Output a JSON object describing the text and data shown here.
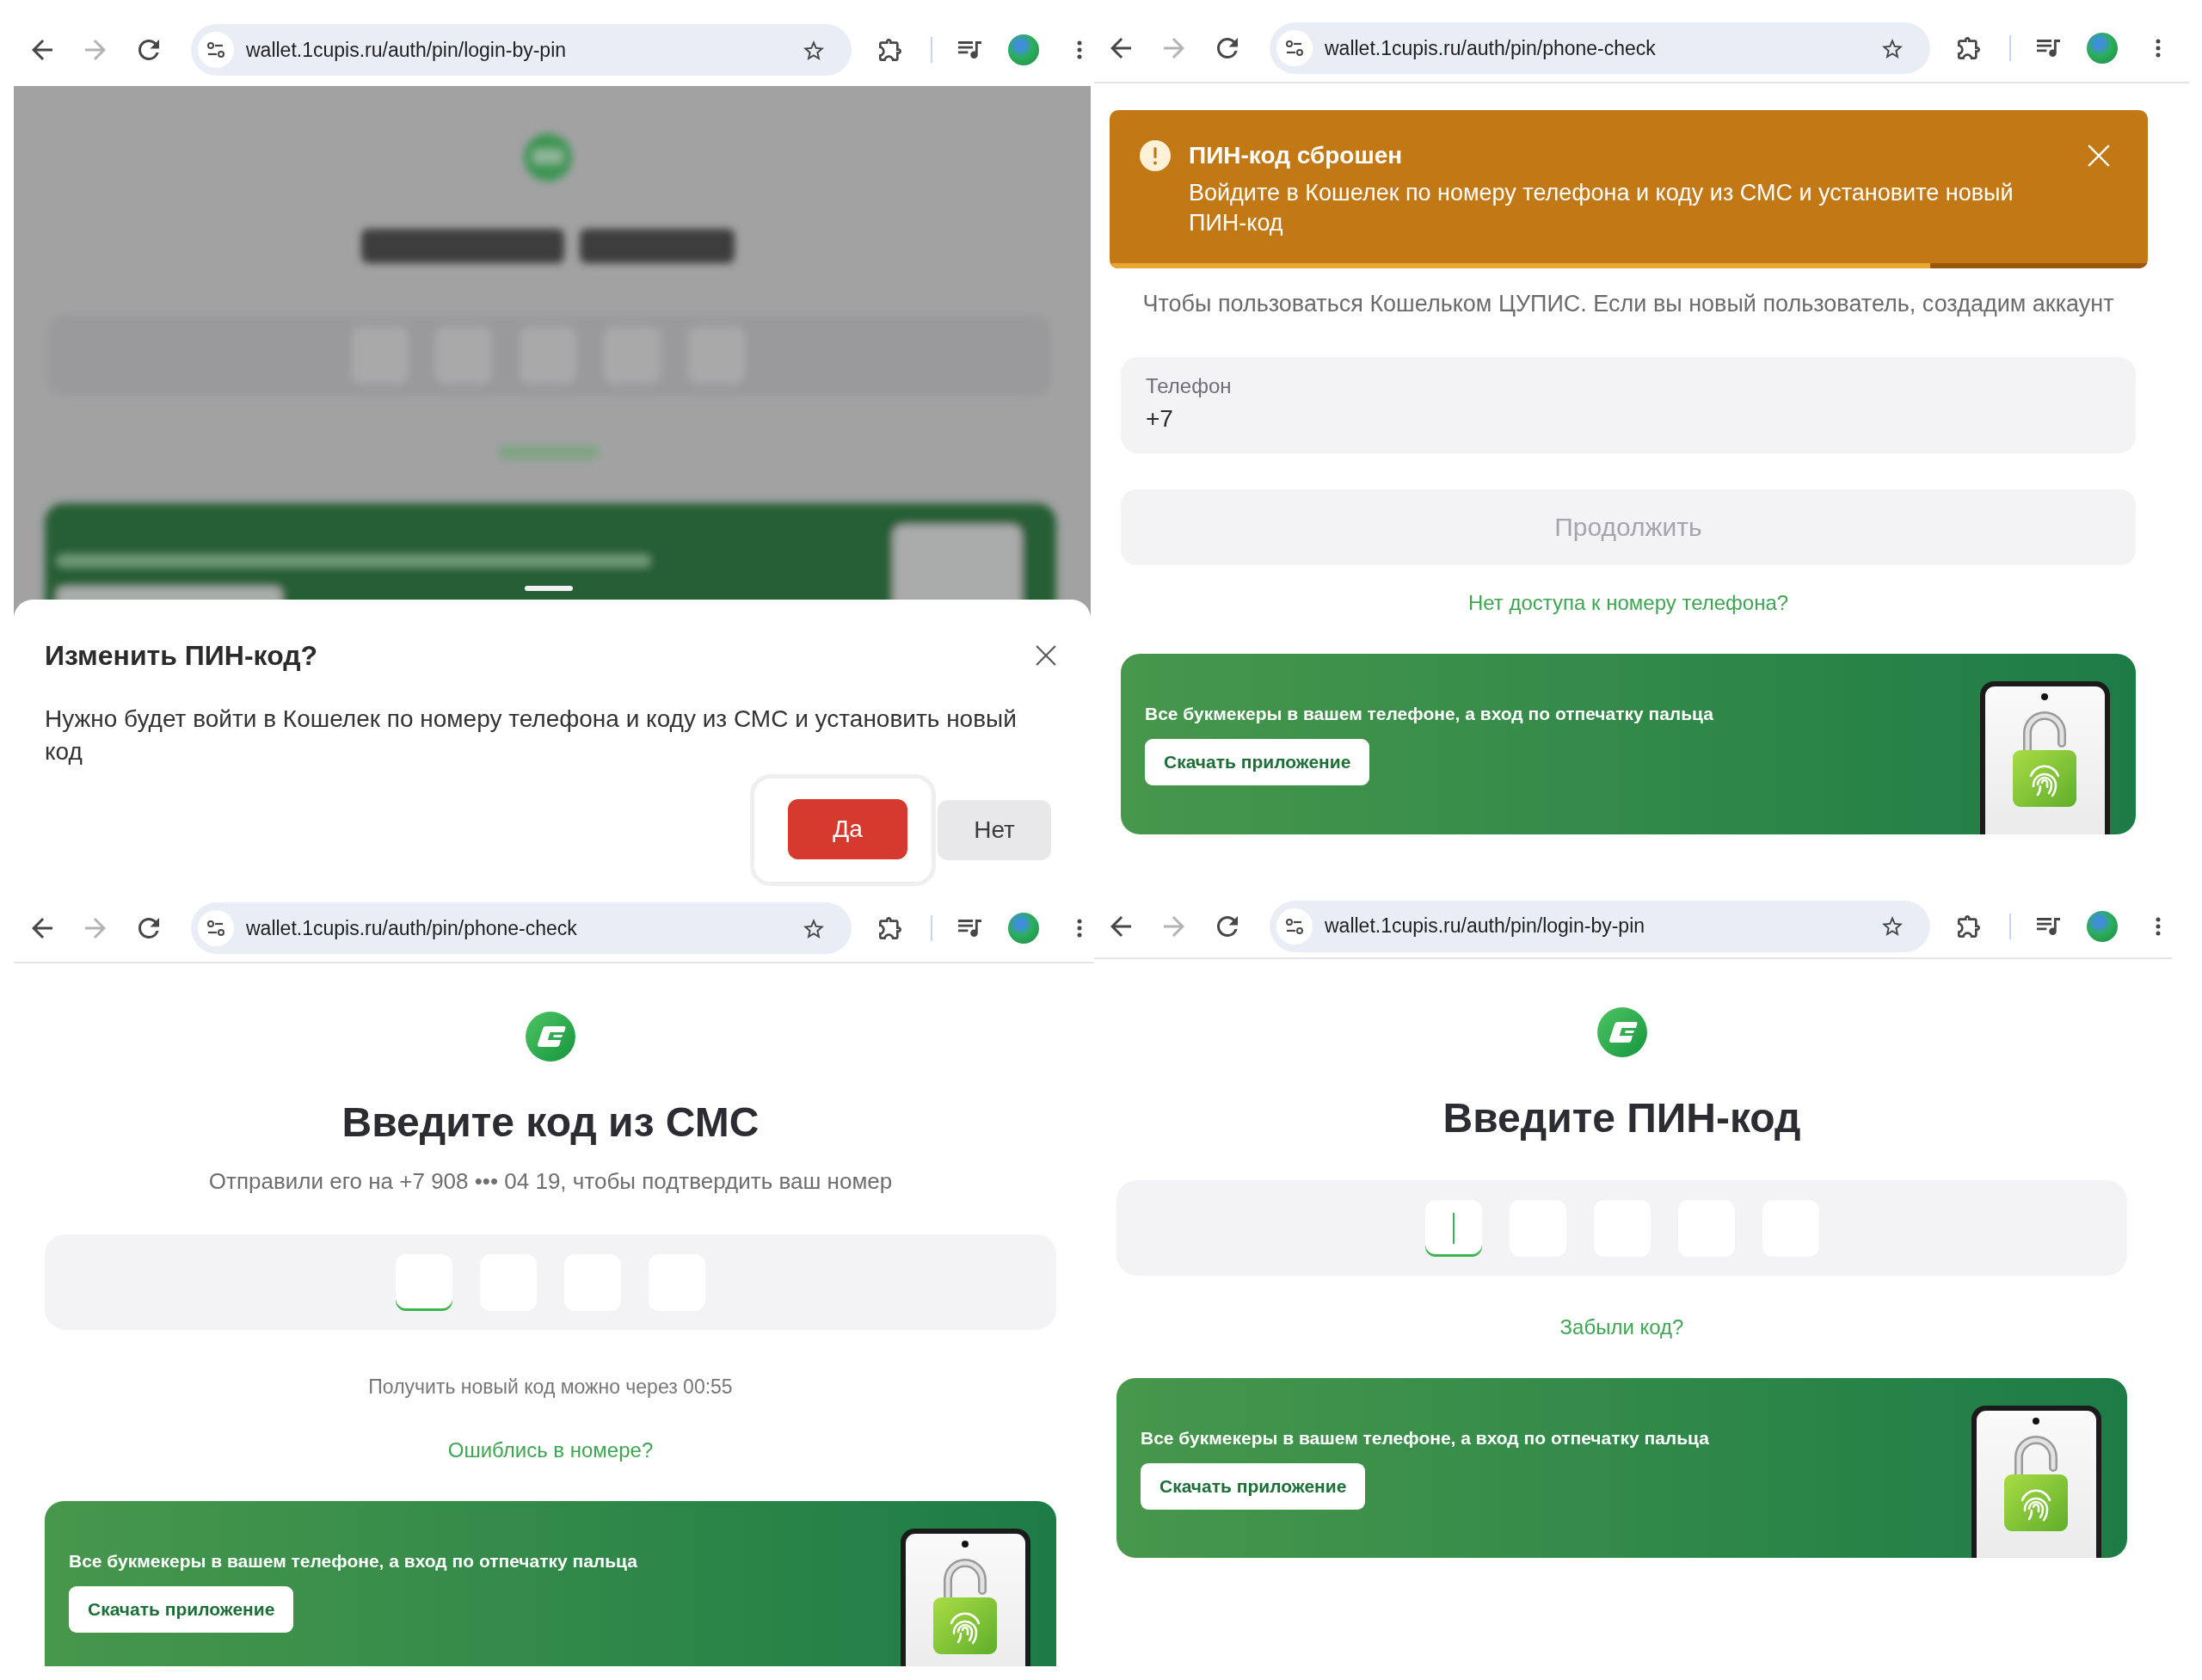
{
  "browser_windows": [
    {
      "kind": "dialog",
      "toolbar": {
        "url": "wallet.1cupis.ru/auth/pin/login-by-pin",
        "forward_enabled": false
      },
      "sheet": {
        "title": "Изменить ПИН-код?",
        "text": "Нужно будет войти в Кошелек по номеру телефона и коду из СМС и установить новый код",
        "buttons": [
          {
            "label": "Да",
            "kind": "primary",
            "focused": true
          },
          {
            "label": "Нет",
            "kind": "secondary",
            "focused": false
          }
        ]
      }
    },
    {
      "kind": "phone_check",
      "toolbar": {
        "url": "wallet.1cupis.ru/auth/pin/phone-check",
        "forward_enabled": false
      },
      "toast": {
        "title": "ПИН-код сброшен",
        "text": "Войдите в Кошелек по номеру телефона и коду из СМС и установите новый ПИН-код",
        "progress": {
          "level": 0.79
        }
      },
      "subtitle": "Чтобы пользоваться Кошельком ЦУПИС. Если вы новый пользователь, создадим аккаунт",
      "phone_field": {
        "label": "Телефон",
        "value": "+7"
      },
      "continue_button": {
        "label": "Продолжить",
        "disabled": true
      },
      "link": "Нет доступа к номеру телефона?",
      "banner": {
        "text": "Все букмекеры в вашем телефоне, а вход по отпечатку пальца",
        "button": "Скачать приложение"
      }
    },
    {
      "kind": "code_entry",
      "toolbar": {
        "url": "wallet.1cupis.ru/auth/pin/phone-check",
        "forward_enabled": false
      },
      "heading": "Введите код из СМС",
      "subtitle": "Отправили его на +7 908 ••• 04 19, чтобы подтвердить ваш номер",
      "code_cells": [
        {
          "focused": true
        },
        {
          "focused": false
        },
        {
          "focused": false
        },
        {
          "focused": false
        }
      ],
      "timer": "Получить новый код можно через 00:55",
      "link": "Ошиблись в номере?",
      "banner": {
        "text": "Все букмекеры в вашем телефоне, а вход по отпечатку пальца",
        "button": "Скачать приложение"
      }
    },
    {
      "kind": "code_entry",
      "toolbar": {
        "url": "wallet.1cupis.ru/auth/pin/login-by-pin",
        "forward_enabled": false
      },
      "heading": "Введите ПИН-код",
      "code_cells": [
        {
          "focused": true,
          "cursor": true
        },
        {
          "focused": false,
          "cursor": false
        },
        {
          "focused": false,
          "cursor": false
        },
        {
          "focused": false,
          "cursor": false
        },
        {
          "focused": false,
          "cursor": false
        }
      ],
      "link": "Забыли код?",
      "banner": {
        "text": "Все букмекеры в вашем телефоне, а вход по отпечатку пальца",
        "button": "Скачать приложение"
      }
    }
  ]
}
